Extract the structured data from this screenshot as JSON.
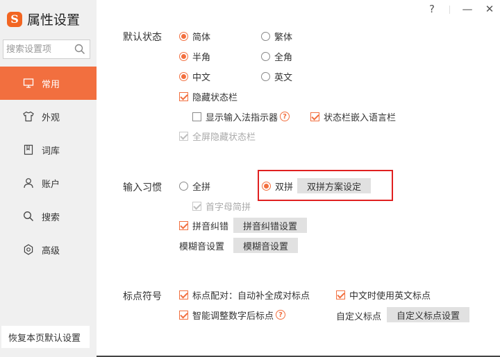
{
  "app": {
    "title": "属性设置",
    "logo_letter": "S"
  },
  "window": {
    "help": "?",
    "minimize": "—",
    "close": "✕"
  },
  "search": {
    "placeholder": "搜索设置项",
    "value": ""
  },
  "sidebar": {
    "items": [
      {
        "label": "常用",
        "icon": "monitor-icon",
        "active": true
      },
      {
        "label": "外观",
        "icon": "tshirt-icon",
        "active": false
      },
      {
        "label": "词库",
        "icon": "book-icon",
        "active": false
      },
      {
        "label": "账户",
        "icon": "user-icon",
        "active": false
      },
      {
        "label": "搜索",
        "icon": "search-icon",
        "active": false
      },
      {
        "label": "高级",
        "icon": "gear-icon",
        "active": false
      }
    ],
    "reset_label": "恢复本页默认设置"
  },
  "default_state": {
    "label": "默认状态",
    "simplified": "简体",
    "traditional": "繁体",
    "half_width": "半角",
    "full_width": "全角",
    "chinese": "中文",
    "english": "英文",
    "hide_status_bar": "隐藏状态栏",
    "show_indicator": "显示输入法指示器",
    "embed_lang_bar": "状态栏嵌入语言栏",
    "fullscreen_hide": "全屏隐藏状态栏"
  },
  "input_habit": {
    "label": "输入习惯",
    "quanpin": "全拼",
    "shuangpin": "双拼",
    "shuangpin_settings": "双拼方案设定",
    "initial_abbrev": "首字母简拼",
    "pinyin_correction": "拼音纠错",
    "pinyin_correction_settings": "拼音纠错设置",
    "fuzzy_label": "模糊音设置",
    "fuzzy_settings": "模糊音设置"
  },
  "punctuation": {
    "label": "标点符号",
    "pairing": "标点配对：自动补全成对标点",
    "english_punct_in_chinese": "中文时使用英文标点",
    "smart_adjust": "智能调整数字后标点",
    "custom_label": "自定义标点",
    "custom_settings": "自定义标点设置"
  },
  "colors": {
    "accent": "#f26f3f",
    "highlight_border": "#e02020"
  }
}
